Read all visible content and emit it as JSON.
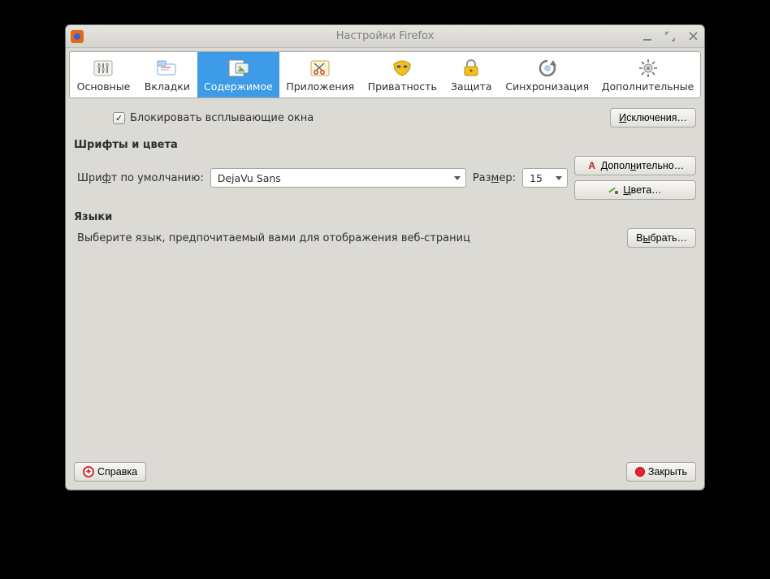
{
  "window": {
    "title": "Настройки Firefox"
  },
  "tabs": {
    "general": "Основные",
    "tabs": "Вкладки",
    "content": "Содержимое",
    "applications": "Приложения",
    "privacy": "Приватность",
    "security": "Защита",
    "sync": "Синхронизация",
    "advanced": "Дополнительные"
  },
  "popup": {
    "block_label": "Блокировать всплывающие окна",
    "exceptions_label": "Исключения…"
  },
  "fonts": {
    "section_title": "Шрифты и цвета",
    "default_label_pre": "Шри",
    "default_label_uk": "ф",
    "default_label_post": "т по умолчанию:",
    "font_value": "DejaVu Sans",
    "size_label_pre": "Раз",
    "size_label_uk": "м",
    "size_label_post": "ер:",
    "size_value": "15",
    "advanced_label_pre": "Допол",
    "advanced_label_uk": "н",
    "advanced_label_post": "ительно…",
    "colors_label_pre": "",
    "colors_label_uk": "Ц",
    "colors_label_post": "вета…"
  },
  "languages": {
    "section_title": "Языки",
    "description": "Выберите язык, предпочитаемый вами для отображения веб-страниц",
    "choose_label_pre": "В",
    "choose_label_uk": "ы",
    "choose_label_post": "брать…"
  },
  "footer": {
    "help_label": "Справка",
    "close_label": "Закрыть"
  }
}
